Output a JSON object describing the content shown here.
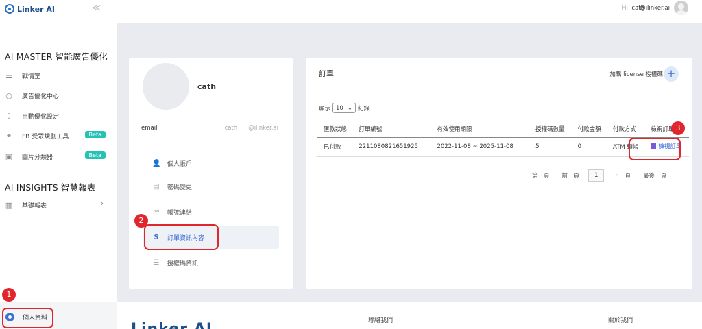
{
  "sidebar": {
    "logo": "Linker AI",
    "collapse": "≪",
    "section1_title": "AI MASTER 智能廣告優化",
    "items1": [
      {
        "label": "戰情室",
        "icon": "☰"
      },
      {
        "label": "廣告優化中心",
        "icon": "○"
      },
      {
        "label": "自動優化設定",
        "icon": "⁚"
      },
      {
        "label": "FB 受眾規劃工具",
        "icon": "⚭",
        "badge": "Beta"
      },
      {
        "label": "圖片分類器",
        "icon": "▣",
        "badge": "Beta"
      }
    ],
    "section2_title": "AI INSIGHTS 智慧報表",
    "items2": [
      {
        "label": "基礎報表",
        "icon": "▥",
        "chevron": "›"
      }
    ],
    "profile_link": "個人資料"
  },
  "header": {
    "greeting": "Hi,",
    "user": "cath",
    "email": "@ilinker.ai"
  },
  "profile": {
    "name": "cath",
    "email_label": "email",
    "email_user": "cath",
    "email_domain": "@ilinker.ai",
    "menu": [
      {
        "label": "個人帳戶",
        "icon": "👤"
      },
      {
        "label": "密碼變更",
        "icon": "▤"
      },
      {
        "label": "帳號連結",
        "icon": "⚯"
      },
      {
        "label": "訂單資訊內容",
        "icon": "S"
      },
      {
        "label": "授權碼資訊",
        "icon": "☰"
      }
    ]
  },
  "orders": {
    "title": "訂單",
    "add_license": "加購 license 授權碼",
    "add_icon": "+",
    "show_label": "顯示",
    "page_size": "10",
    "records_label": "紀錄",
    "columns": [
      "匯款狀態",
      "訂單編號",
      "有效使用期限",
      "授權碼數量",
      "付款金額",
      "付款方式",
      "檢視訂單"
    ],
    "rows": [
      {
        "status": "已付款",
        "order_no": "2211080821651925",
        "period": "2022-11-08 ~ 2025-11-08",
        "qty": "5",
        "amount": "0",
        "method": "ATM 轉帳",
        "view": "檢視訂單"
      }
    ],
    "pager": {
      "first": "第一頁",
      "prev": "前一頁",
      "current": "1",
      "next": "下一頁",
      "last": "最後一頁"
    }
  },
  "annotations": [
    "1",
    "2",
    "3"
  ],
  "footer": {
    "logo": "Linker AI",
    "contact": "聯絡我們",
    "about": "關於我們"
  },
  "colors": {
    "accent": "#3d6fd6",
    "badge": "#26c2b6",
    "annotation": "#e0252c"
  }
}
